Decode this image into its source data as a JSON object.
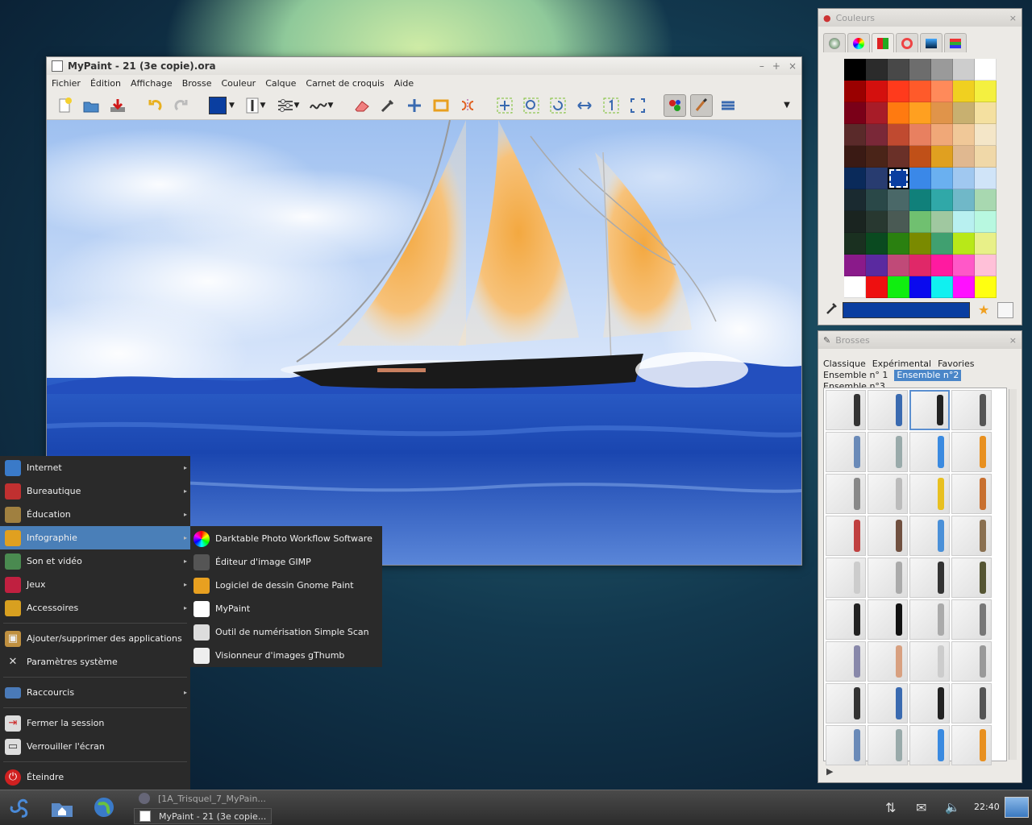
{
  "mypaint": {
    "title": "MyPaint - 21 (3e copie).ora",
    "controls": {
      "minimize": "–",
      "maximize": "+",
      "close": "×"
    },
    "menu": [
      "Fichier",
      "Édition",
      "Affichage",
      "Brosse",
      "Couleur",
      "Calque",
      "Carnet de croquis",
      "Aide"
    ],
    "brush_color": "#0a3ea0"
  },
  "colors_panel": {
    "title": "Couleurs",
    "close": "×",
    "current_color": "#0a3ea0",
    "palette": [
      [
        "#000000",
        "#2b2b2b",
        "#484848",
        "#6d6d6d",
        "#9a9a9a",
        "#cdcdcd",
        "#ffffff"
      ],
      [
        "#9a0000",
        "#d4100e",
        "#ff3a1c",
        "#ff5a2a",
        "#ff8a5a",
        "#f0d020",
        "#f4f040"
      ],
      [
        "#7a0018",
        "#a81c28",
        "#ff7a10",
        "#ffa020",
        "#e0944a",
        "#c8b070",
        "#f4e0a0"
      ],
      [
        "#5a2a2a",
        "#7a2838",
        "#c04a30",
        "#e88060",
        "#f0a878",
        "#f0c898",
        "#f4e6c8"
      ],
      [
        "#3a1a14",
        "#4a2418",
        "#6a3028",
        "#c05018",
        "#e0a020",
        "#e0b890",
        "#f0d8a8"
      ],
      [
        "#0a2a5a",
        "#283c70",
        "#0a3ea0",
        "#3a88e8",
        "#6ab0f0",
        "#a0c8f0",
        "#d0e4f8"
      ],
      [
        "#1a2a30",
        "#2a4848",
        "#4a6868",
        "#10807a",
        "#30a8a8",
        "#70b8c8",
        "#a8d8b0"
      ],
      [
        "#1a2420",
        "#283830",
        "#4a5a54",
        "#70c070",
        "#a0c8a0",
        "#b8f0f0",
        "#b8f8e0"
      ],
      [
        "#1a3020",
        "#0a4a20",
        "#2a8010",
        "#7a8a00",
        "#40a070",
        "#b8e818",
        "#e8f088"
      ],
      [
        "#8a1a8a",
        "#5a2aa0",
        "#c04a78",
        "#e02868",
        "#ff1aa0",
        "#ff58c8",
        "#ffc0d8"
      ],
      [
        "#ffffff",
        "#ee1010",
        "#10ee10",
        "#0a0aee",
        "#10f0f0",
        "#ff10ff",
        "#ffff10"
      ]
    ]
  },
  "brushes_panel": {
    "title": "Brosses",
    "close": "×",
    "groups": [
      "Classique",
      "Expérimental",
      "Favories",
      "Ensemble n° 1",
      "Ensemble n°2",
      "Ensemble n°3"
    ],
    "active_group": "Ensemble n°2"
  },
  "start_menu": {
    "categories": [
      {
        "label": "Internet",
        "icon": "globe-icon"
      },
      {
        "label": "Bureautique",
        "icon": "office-icon"
      },
      {
        "label": "Éducation",
        "icon": "education-icon"
      },
      {
        "label": "Infographie",
        "icon": "graphics-icon"
      },
      {
        "label": "Son et vidéo",
        "icon": "media-icon"
      },
      {
        "label": "Jeux",
        "icon": "games-icon"
      },
      {
        "label": "Accessoires",
        "icon": "accessories-icon"
      }
    ],
    "system": [
      "Ajouter/supprimer des applications",
      "Paramètres système"
    ],
    "shortcuts": "Raccourcis",
    "session": [
      "Fermer la session",
      "Verrouiller l'écran"
    ],
    "shutdown": "Éteindre"
  },
  "submenu": [
    "Darktable Photo Workflow Software",
    "Éditeur d'image GIMP",
    "Logiciel de dessin Gnome Paint",
    "MyPaint",
    "Outil de numérisation Simple Scan",
    "Visionneur d'images gThumb"
  ],
  "taskbar": {
    "tasks": [
      "[1A_Trisquel_7_MyPain...",
      "MyPaint - 21 (3e copie..."
    ],
    "clock": "22:40"
  }
}
